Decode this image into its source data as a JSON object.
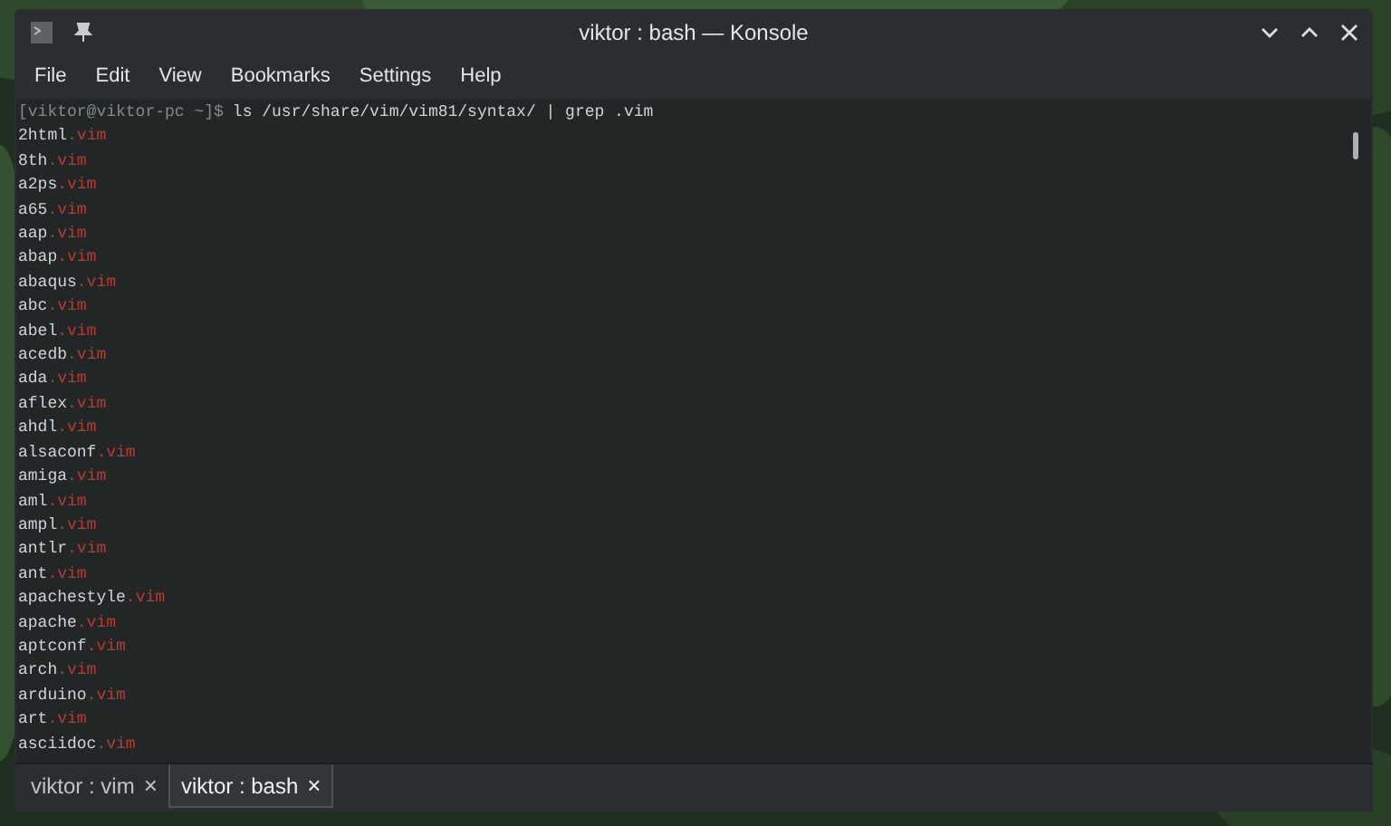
{
  "window": {
    "title": "viktor : bash — Konsole"
  },
  "menu": [
    "File",
    "Edit",
    "View",
    "Bookmarks",
    "Settings",
    "Help"
  ],
  "terminal": {
    "prompt": "[viktor@viktor-pc ~]$",
    "command": "ls /usr/share/vim/vim81/syntax/ | grep .vim",
    "output": [
      {
        "name": "2html",
        "match": ".vim"
      },
      {
        "name": "8th",
        "match": ".vim"
      },
      {
        "name": "a2ps",
        "match": ".vim"
      },
      {
        "name": "a65",
        "match": ".vim"
      },
      {
        "name": "aap",
        "match": ".vim"
      },
      {
        "name": "abap",
        "match": ".vim"
      },
      {
        "name": "abaqus",
        "match": ".vim"
      },
      {
        "name": "abc",
        "match": ".vim"
      },
      {
        "name": "abel",
        "match": ".vim"
      },
      {
        "name": "acedb",
        "match": ".vim"
      },
      {
        "name": "ada",
        "match": ".vim"
      },
      {
        "name": "aflex",
        "match": ".vim"
      },
      {
        "name": "ahdl",
        "match": ".vim"
      },
      {
        "name": "alsaconf",
        "match": ".vim"
      },
      {
        "name": "amiga",
        "match": ".vim"
      },
      {
        "name": "aml",
        "match": ".vim"
      },
      {
        "name": "ampl",
        "match": ".vim"
      },
      {
        "name": "antlr",
        "match": ".vim"
      },
      {
        "name": "ant",
        "match": ".vim"
      },
      {
        "name": "apachestyle",
        "match": ".vim"
      },
      {
        "name": "apache",
        "match": ".vim"
      },
      {
        "name": "aptconf",
        "match": ".vim"
      },
      {
        "name": "arch",
        "match": ".vim"
      },
      {
        "name": "arduino",
        "match": ".vim"
      },
      {
        "name": "art",
        "match": ".vim"
      },
      {
        "name": "asciidoc",
        "match": ".vim"
      }
    ]
  },
  "tabs": [
    {
      "label": "viktor : vim",
      "close": "×",
      "selected": false
    },
    {
      "label": "viktor : bash",
      "close": "×",
      "selected": true
    }
  ]
}
